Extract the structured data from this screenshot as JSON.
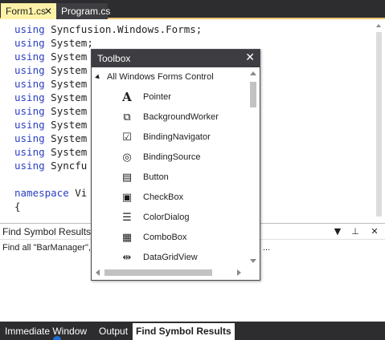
{
  "doc_tabs": [
    {
      "label": "Form1.cs",
      "close_glyph": "✕",
      "active": true
    },
    {
      "label": "Program.cs",
      "active": false
    }
  ],
  "code_lines": [
    {
      "kw": "using",
      "text": " Syncfusion.Windows.Forms;"
    },
    {
      "kw": "using",
      "text": " System;"
    },
    {
      "kw": "using",
      "text": " System"
    },
    {
      "kw": "using",
      "text": " System"
    },
    {
      "kw": "using",
      "text": " System"
    },
    {
      "kw": "using",
      "text": " System"
    },
    {
      "kw": "using",
      "text": " System"
    },
    {
      "kw": "using",
      "text": " System"
    },
    {
      "kw": "using",
      "text": " System"
    },
    {
      "kw": "using",
      "text": " System"
    },
    {
      "kw": "using",
      "text": " Syncfu"
    },
    {
      "kw": "",
      "text": ""
    },
    {
      "kw": "namespace",
      "text": " Vi"
    },
    {
      "kw": "",
      "text": "{"
    }
  ],
  "find_panel": {
    "title": "Find Symbol Results",
    "pin_glyph": "⊥",
    "close_glyph": "✕",
    "dropdown_glyph": "▼",
    "result_text": "Find all \"BarManager\",",
    "result_tail": "..."
  },
  "bottom_tabs": [
    {
      "label": "Immediate Window",
      "active": false
    },
    {
      "label": "Output",
      "active": false
    },
    {
      "label": "Find Symbol Results",
      "active": true
    }
  ],
  "toolbox": {
    "title": "Toolbox",
    "close_glyph": "✕",
    "category": "All Windows Forms Control",
    "items": [
      {
        "label": "Pointer",
        "icon": "pointer-icon",
        "glyph": "A"
      },
      {
        "label": "BackgroundWorker",
        "icon": "background-worker-icon",
        "glyph": "⧉"
      },
      {
        "label": "BindingNavigator",
        "icon": "binding-navigator-icon",
        "glyph": "☑"
      },
      {
        "label": "BindingSource",
        "icon": "binding-source-icon",
        "glyph": "◎"
      },
      {
        "label": "Button",
        "icon": "button-icon",
        "glyph": "▤"
      },
      {
        "label": "CheckBox",
        "icon": "checkbox-icon",
        "glyph": "▣"
      },
      {
        "label": "ColorDialog",
        "icon": "color-dialog-icon",
        "glyph": "☰"
      },
      {
        "label": "ComboBox",
        "icon": "combobox-icon",
        "glyph": "▦"
      },
      {
        "label": "DataGridView",
        "icon": "datagridview-icon",
        "glyph": "⇹"
      }
    ]
  },
  "colors": {
    "keyword": "#2b3fc2",
    "active_doc_tab": "#fff2a8",
    "dark_chrome": "#2d2d30",
    "toolbox_header": "#3e3e42"
  }
}
